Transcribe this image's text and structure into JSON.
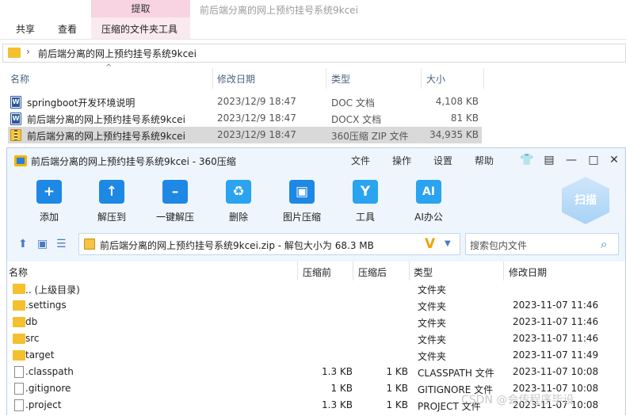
{
  "explorer": {
    "window_title": "前后端分离的网上预约挂号系统9kcei",
    "ribbon": {
      "context_header": "提取",
      "tabs": [
        "共享",
        "查看"
      ],
      "context_tab": "压缩的文件夹工具"
    },
    "address": {
      "separator": "›",
      "path": "前后端分离的网上预约挂号系统9kcei"
    },
    "columns": {
      "name": "名称",
      "date": "修改日期",
      "type": "类型",
      "size": "大小",
      "sort_indicator": "^"
    },
    "files": [
      {
        "name": "springboot开发环境说明",
        "date": "2023/12/9 18:47",
        "type": "DOC 文档",
        "size": "4,108 KB",
        "icon": "word-doc-icon"
      },
      {
        "name": "前后端分离的网上预约挂号系统9kcei",
        "date": "2023/12/9 18:47",
        "type": "DOCX 文档",
        "size": "81 KB",
        "icon": "word-docx-icon"
      },
      {
        "name": "前后端分离的网上预约挂号系统9kcei",
        "date": "2023/12/9 18:47",
        "type": "360压缩 ZIP 文件",
        "size": "34,935 KB",
        "icon": "zip-archive-icon",
        "selected": true
      }
    ]
  },
  "zip_window": {
    "title": "前后端分离的网上预约挂号系统9kcei - 360压缩",
    "menu": [
      "文件",
      "操作",
      "设置",
      "帮助"
    ],
    "controls": [
      "skin-icon",
      "feedback-icon",
      "minimize-icon",
      "maximize-icon",
      "close-icon"
    ],
    "toolbar": [
      {
        "label": "添加",
        "icon": "add-icon"
      },
      {
        "label": "解压到",
        "icon": "extract-to-icon"
      },
      {
        "label": "一键解压",
        "icon": "quick-extract-icon"
      },
      {
        "label": "删除",
        "icon": "delete-icon"
      },
      {
        "label": "图片压缩",
        "icon": "image-compress-icon"
      },
      {
        "label": "工具",
        "icon": "tools-icon"
      },
      {
        "label": "AI办公",
        "icon": "ai-office-icon"
      }
    ],
    "scan_label": "扫描",
    "path_text": "前后端分离的网上预约挂号系统9kcei.zip - 解包大小为 68.3 MB",
    "path_badge": "V",
    "search_placeholder": "搜索包内文件",
    "columns": {
      "name": "名称",
      "compressed": "压缩前",
      "original": "压缩后",
      "type": "类型",
      "date": "修改日期"
    },
    "rows": [
      {
        "name": ".. (上级目录)",
        "compressed": "",
        "original": "",
        "type": "文件夹",
        "date": "",
        "kind": "folder"
      },
      {
        "name": ".settings",
        "compressed": "",
        "original": "",
        "type": "文件夹",
        "date": "2023-11-07 11:46",
        "kind": "folder"
      },
      {
        "name": "db",
        "compressed": "",
        "original": "",
        "type": "文件夹",
        "date": "2023-11-07 11:46",
        "kind": "folder"
      },
      {
        "name": "src",
        "compressed": "",
        "original": "",
        "type": "文件夹",
        "date": "2023-11-07 11:46",
        "kind": "folder"
      },
      {
        "name": "target",
        "compressed": "",
        "original": "",
        "type": "文件夹",
        "date": "2023-11-07 11:49",
        "kind": "folder"
      },
      {
        "name": ".classpath",
        "compressed": "1.3 KB",
        "original": "1 KB",
        "type": "CLASSPATH 文件",
        "date": "2023-11-07 10:08",
        "kind": "file"
      },
      {
        "name": ".gitignore",
        "compressed": "1 KB",
        "original": "1 KB",
        "type": "GITIGNORE 文件",
        "date": "2023-11-07 10:08",
        "kind": "file"
      },
      {
        "name": ".project",
        "compressed": "1.3 KB",
        "original": "1 KB",
        "type": "PROJECT 文件",
        "date": "2023-11-07 10:08",
        "kind": "file"
      }
    ]
  },
  "watermark": "CSDN @会传程序毕设"
}
